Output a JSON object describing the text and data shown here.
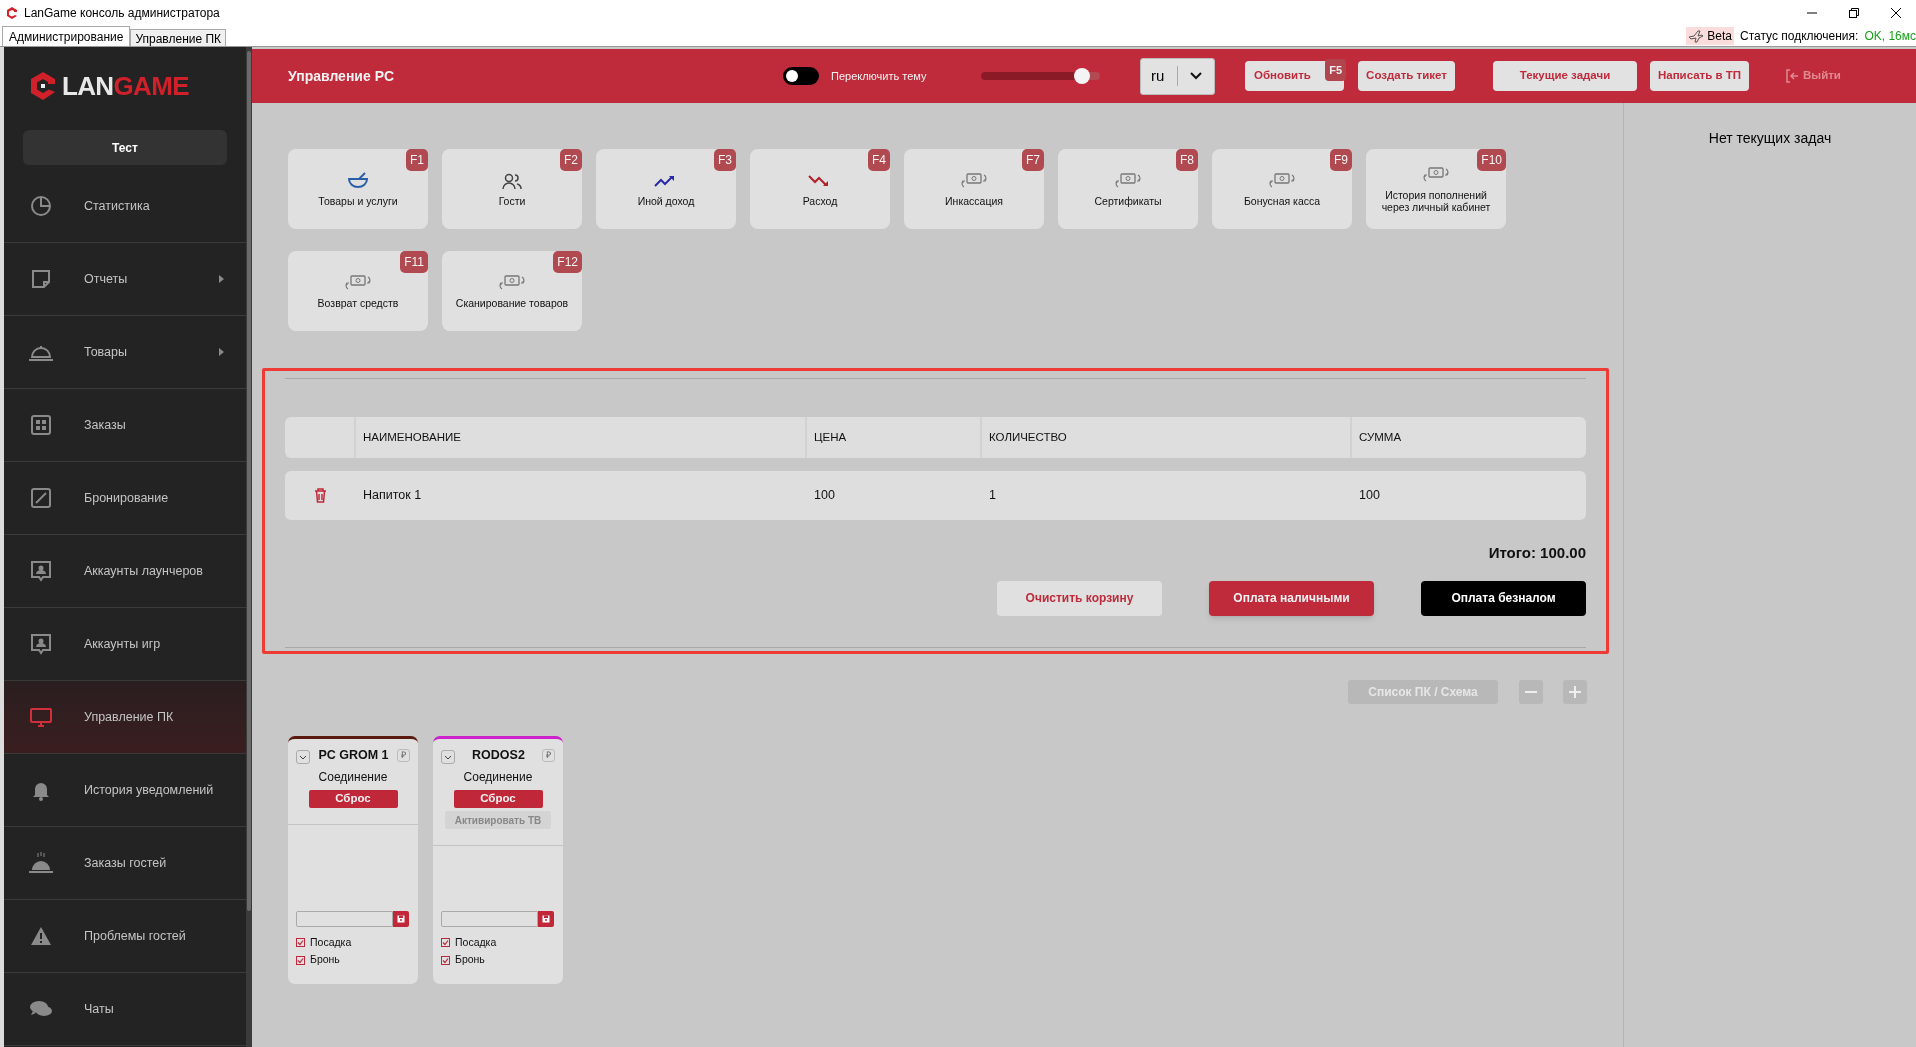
{
  "window": {
    "title": "LanGame консоль администратора"
  },
  "tabs": [
    {
      "label": "Администрирование",
      "selected": true
    },
    {
      "label": "Управление ПК",
      "selected": false
    }
  ],
  "status": {
    "badge": "Beta",
    "label": "Статус подключения:",
    "value": "OK, 16мс"
  },
  "sidebar": {
    "logo": {
      "part_1": "LAN",
      "part_2": "GAME"
    },
    "user_button": "Тест",
    "items": [
      {
        "label": "Статистика",
        "has_submenu": false,
        "selected": false
      },
      {
        "label": "Отчеты",
        "has_submenu": true,
        "selected": false
      },
      {
        "label": "Товары",
        "has_submenu": true,
        "selected": false
      },
      {
        "label": "Заказы",
        "has_submenu": false,
        "selected": false
      },
      {
        "label": "Бронирование",
        "has_submenu": false,
        "selected": false
      },
      {
        "label": "Аккаунты лаунчеров",
        "has_submenu": false,
        "selected": false
      },
      {
        "label": "Аккаунты игр",
        "has_submenu": false,
        "selected": false
      },
      {
        "label": "Управление ПК",
        "has_submenu": false,
        "selected": true
      },
      {
        "label": "История уведомлений",
        "has_submenu": false,
        "selected": false
      },
      {
        "label": "Заказы гостей",
        "has_submenu": false,
        "selected": false
      },
      {
        "label": "Проблемы гостей",
        "has_submenu": false,
        "selected": false
      },
      {
        "label": "Чаты",
        "has_submenu": false,
        "selected": false
      }
    ]
  },
  "header": {
    "title": "Управление PC",
    "theme_toggle": {
      "label": "Переключить тему",
      "on": false
    },
    "slider": {
      "level": 0.85
    },
    "language": {
      "value": "ru"
    },
    "buttons": [
      {
        "label": "Обновить",
        "hotkey": "F5"
      },
      {
        "label": "Создать тикет"
      },
      {
        "label": "Текущие задачи"
      },
      {
        "label": "Написать в ТП"
      }
    ],
    "logout": {
      "label": "Выйти",
      "disabled": true
    }
  },
  "actions": [
    {
      "label": "Товары и услуги",
      "hotkey": "F1"
    },
    {
      "label": "Гости",
      "hotkey": "F2"
    },
    {
      "label": "Иной доход",
      "hotkey": "F3"
    },
    {
      "label": "Расход",
      "hotkey": "F4"
    },
    {
      "label": "Инкассация",
      "hotkey": "F7"
    },
    {
      "label": "Сертификаты",
      "hotkey": "F8"
    },
    {
      "label": "Бонусная касса",
      "hotkey": "F9"
    },
    {
      "label": "История пополнений через личный кабинет",
      "hotkey": "F10"
    },
    {
      "label": "Возврат средств",
      "hotkey": "F11"
    },
    {
      "label": "Сканирование товаров",
      "hotkey": "F12"
    }
  ],
  "cart": {
    "columns": [
      "НАИМЕНОВАНИЕ",
      "ЦЕНА",
      "КОЛИЧЕСТВО",
      "СУММА"
    ],
    "rows": [
      {
        "name": "Напиток 1",
        "price": "100",
        "quantity": "1",
        "sum": "100"
      }
    ],
    "total": "Итого: 100.00",
    "buttons": [
      {
        "label": "Очистить корзину",
        "kind": "secondary"
      },
      {
        "label": "Оплата наличными",
        "kind": "primary"
      },
      {
        "label": "Оплата безналом",
        "kind": "dark"
      }
    ]
  },
  "pc_view": {
    "toggle_label": "Список ПК / Схема",
    "pcs": [
      {
        "name": "PC GROM 1",
        "color": "#5a1a10",
        "status": "Соединение",
        "currency": "₽",
        "reset": "Сброс",
        "checkboxes": [
          {
            "label": "Посадка",
            "checked": true
          },
          {
            "label": "Бронь",
            "checked": true
          }
        ]
      },
      {
        "name": "RODOS2",
        "color": "#cc22cc",
        "status": "Соединение",
        "currency": "₽",
        "reset": "Сброс",
        "tv_button": {
          "label": "Активировать ТВ",
          "disabled": true
        },
        "checkboxes": [
          {
            "label": "Посадка",
            "checked": true
          },
          {
            "label": "Бронь",
            "checked": true
          }
        ]
      }
    ]
  },
  "tasks_panel": {
    "empty_text": "Нет текущих задач"
  }
}
